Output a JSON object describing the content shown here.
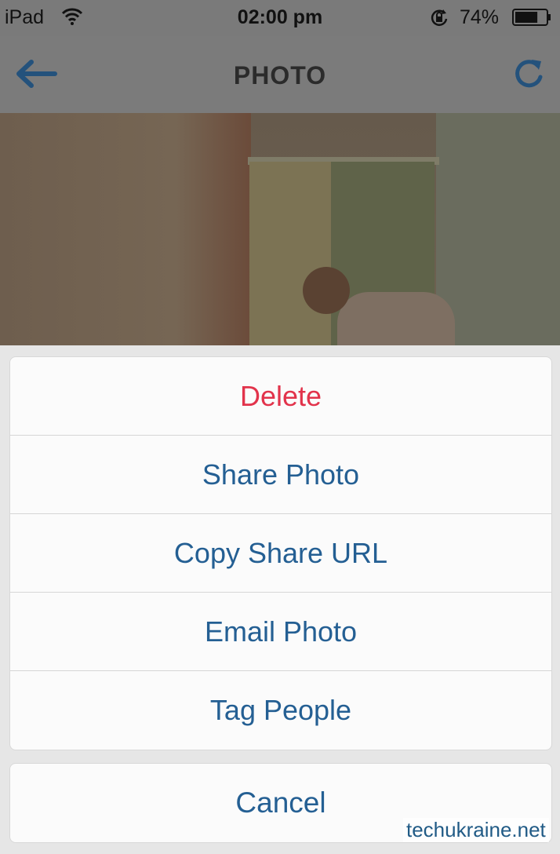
{
  "status_bar": {
    "carrier": "iPad",
    "time": "02:00 pm",
    "battery_percent": "74%",
    "battery_level": 0.74,
    "icons": [
      "wifi-icon",
      "rotation-lock-icon",
      "battery-icon"
    ]
  },
  "navbar": {
    "title": "PHOTO",
    "back_icon": "arrow-left-icon",
    "refresh_icon": "refresh-icon",
    "accent_color": "#245f93"
  },
  "action_sheet": {
    "items": [
      {
        "label": "Delete",
        "destructive": true
      },
      {
        "label": "Share Photo"
      },
      {
        "label": "Copy Share URL"
      },
      {
        "label": "Email Photo"
      },
      {
        "label": "Tag People"
      }
    ],
    "cancel_label": "Cancel",
    "destructive_color": "#e2334b"
  },
  "watermark": "techukraine.net"
}
